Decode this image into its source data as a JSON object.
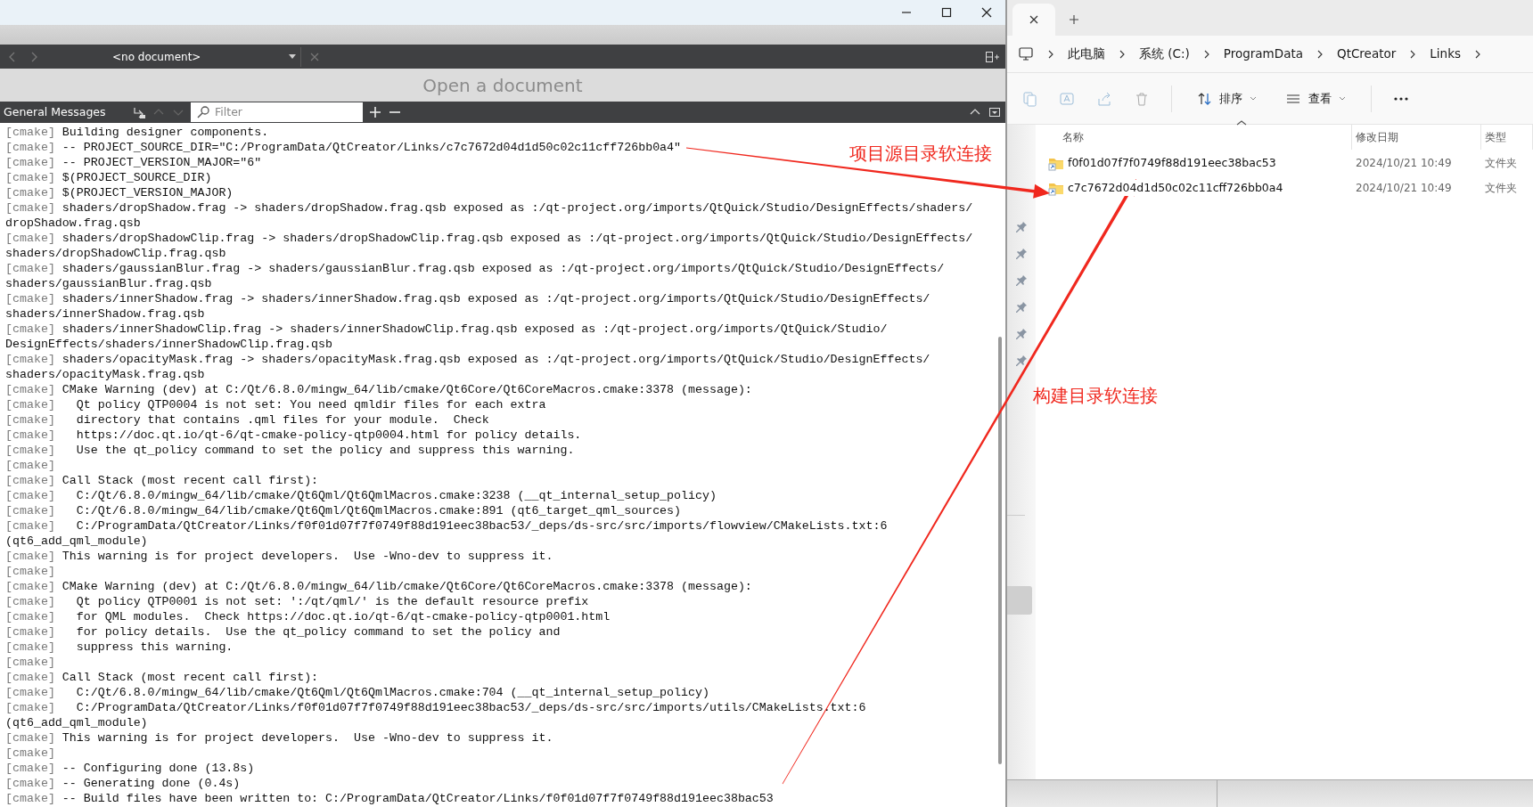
{
  "editor": {
    "document": "<no document>",
    "placeholder": "Open a document"
  },
  "output_pane": {
    "title": "General Messages",
    "filter": {
      "placeholder": "Filter"
    },
    "lines": [
      {
        "tag": "[cmake]",
        "text": "Building designer components."
      },
      {
        "tag": "[cmake]",
        "text": "-- PROJECT_SOURCE_DIR=\"C:/ProgramData/QtCreator/Links/c7c7672d04d1d50c02c11cff726bb0a4\""
      },
      {
        "tag": "[cmake]",
        "text": "-- PROJECT_VERSION_MAJOR=\"6\""
      },
      {
        "tag": "[cmake]",
        "text": "$(PROJECT_SOURCE_DIR)"
      },
      {
        "tag": "[cmake]",
        "text": "$(PROJECT_VERSION_MAJOR)"
      },
      {
        "tag": "[cmake]",
        "text": "shaders/dropShadow.frag -> shaders/dropShadow.frag.qsb exposed as :/qt-project.org/imports/QtQuick/Studio/DesignEffects/shaders/"
      },
      {
        "text": "dropShadow.frag.qsb"
      },
      {
        "tag": "[cmake]",
        "text": "shaders/dropShadowClip.frag -> shaders/dropShadowClip.frag.qsb exposed as :/qt-project.org/imports/QtQuick/Studio/DesignEffects/"
      },
      {
        "text": "shaders/dropShadowClip.frag.qsb"
      },
      {
        "tag": "[cmake]",
        "text": "shaders/gaussianBlur.frag -> shaders/gaussianBlur.frag.qsb exposed as :/qt-project.org/imports/QtQuick/Studio/DesignEffects/"
      },
      {
        "text": "shaders/gaussianBlur.frag.qsb"
      },
      {
        "tag": "[cmake]",
        "text": "shaders/innerShadow.frag -> shaders/innerShadow.frag.qsb exposed as :/qt-project.org/imports/QtQuick/Studio/DesignEffects/"
      },
      {
        "text": "shaders/innerShadow.frag.qsb"
      },
      {
        "tag": "[cmake]",
        "text": "shaders/innerShadowClip.frag -> shaders/innerShadowClip.frag.qsb exposed as :/qt-project.org/imports/QtQuick/Studio/"
      },
      {
        "text": "DesignEffects/shaders/innerShadowClip.frag.qsb"
      },
      {
        "tag": "[cmake]",
        "text": "shaders/opacityMask.frag -> shaders/opacityMask.frag.qsb exposed as :/qt-project.org/imports/QtQuick/Studio/DesignEffects/"
      },
      {
        "text": "shaders/opacityMask.frag.qsb"
      },
      {
        "tag": "[cmake]",
        "text": "CMake Warning (dev) at C:/Qt/6.8.0/mingw_64/lib/cmake/Qt6Core/Qt6CoreMacros.cmake:3378 (message):"
      },
      {
        "tag": "[cmake]",
        "text": "  Qt policy QTP0004 is not set: You need qmldir files for each extra"
      },
      {
        "tag": "[cmake]",
        "text": "  directory that contains .qml files for your module.  Check"
      },
      {
        "tag": "[cmake]",
        "text": "  https://doc.qt.io/qt-6/qt-cmake-policy-qtp0004.html for policy details."
      },
      {
        "tag": "[cmake]",
        "text": "  Use the qt_policy command to set the policy and suppress this warning."
      },
      {
        "tag": "[cmake]"
      },
      {
        "tag": "[cmake]",
        "text": "Call Stack (most recent call first):"
      },
      {
        "tag": "[cmake]",
        "text": "  C:/Qt/6.8.0/mingw_64/lib/cmake/Qt6Qml/Qt6QmlMacros.cmake:3238 (__qt_internal_setup_policy)"
      },
      {
        "tag": "[cmake]",
        "text": "  C:/Qt/6.8.0/mingw_64/lib/cmake/Qt6Qml/Qt6QmlMacros.cmake:891 (qt6_target_qml_sources)"
      },
      {
        "tag": "[cmake]",
        "text": "  C:/ProgramData/QtCreator/Links/f0f01d07f7f0749f88d191eec38bac53/_deps/ds-src/src/imports/flowview/CMakeLists.txt:6"
      },
      {
        "text": "(qt6_add_qml_module)"
      },
      {
        "tag": "[cmake]",
        "text": "This warning is for project developers.  Use -Wno-dev to suppress it."
      },
      {
        "tag": "[cmake]"
      },
      {
        "tag": "[cmake]",
        "text": "CMake Warning (dev) at C:/Qt/6.8.0/mingw_64/lib/cmake/Qt6Core/Qt6CoreMacros.cmake:3378 (message):"
      },
      {
        "tag": "[cmake]",
        "text": "  Qt policy QTP0001 is not set: ':/qt/qml/' is the default resource prefix"
      },
      {
        "tag": "[cmake]",
        "text": "  for QML modules.  Check https://doc.qt.io/qt-6/qt-cmake-policy-qtp0001.html"
      },
      {
        "tag": "[cmake]",
        "text": "  for policy details.  Use the qt_policy command to set the policy and"
      },
      {
        "tag": "[cmake]",
        "text": "  suppress this warning."
      },
      {
        "tag": "[cmake]"
      },
      {
        "tag": "[cmake]",
        "text": "Call Stack (most recent call first):"
      },
      {
        "tag": "[cmake]",
        "text": "  C:/Qt/6.8.0/mingw_64/lib/cmake/Qt6Qml/Qt6QmlMacros.cmake:704 (__qt_internal_setup_policy)"
      },
      {
        "tag": "[cmake]",
        "text": "  C:/ProgramData/QtCreator/Links/f0f01d07f7f0749f88d191eec38bac53/_deps/ds-src/src/imports/utils/CMakeLists.txt:6"
      },
      {
        "text": "(qt6_add_qml_module)"
      },
      {
        "tag": "[cmake]",
        "text": "This warning is for project developers.  Use -Wno-dev to suppress it."
      },
      {
        "tag": "[cmake]"
      },
      {
        "tag": "[cmake]",
        "text": "-- Configuring done (13.8s)"
      },
      {
        "tag": "[cmake]",
        "text": "-- Generating done (0.4s)"
      },
      {
        "tag": "[cmake]",
        "text": "-- Build files have been written to: C:/ProgramData/QtCreator/Links/f0f01d07f7f0749f88d191eec38bac53"
      }
    ]
  },
  "explorer": {
    "breadcrumb": [
      "此电脑",
      "系统 (C:)",
      "ProgramData",
      "QtCreator",
      "Links"
    ],
    "toolbar": [
      {
        "kind": "sort",
        "label": "排序"
      },
      {
        "kind": "view",
        "label": "查看"
      }
    ],
    "columns": [
      {
        "label": "名称",
        "sorted": true
      },
      {
        "label": "修改日期",
        "sorted": false
      },
      {
        "label": "类型",
        "sorted": false
      }
    ],
    "rows": [
      {
        "name": "f0f01d07f7f0749f88d191eec38bac53",
        "modified": "2024/10/21 10:49",
        "type": "文件夹"
      },
      {
        "name": "c7c7672d04d1d50c02c11cff726bb0a4",
        "modified": "2024/10/21 10:49",
        "type": "文件夹"
      }
    ]
  },
  "annotations": [
    {
      "text": "项目源目录软连接"
    },
    {
      "text": "构建目录软连接"
    }
  ]
}
